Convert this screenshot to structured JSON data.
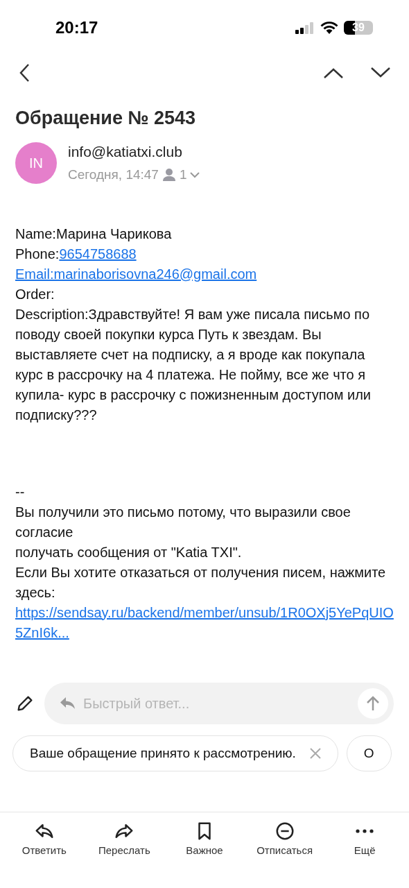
{
  "status_bar": {
    "time": "20:17",
    "battery": "39"
  },
  "subject": "Обращение № 2543",
  "sender": {
    "initials": "IN",
    "color": "#e57fcb",
    "address": "info@katiatxi.club",
    "date": "Сегодня, 14:47",
    "recipients": "1"
  },
  "body": [
    {
      "parts": [
        {
          "kind": "text",
          "text": "Name:Марина Чарикова"
        }
      ]
    },
    {
      "parts": [
        {
          "kind": "text",
          "text": "Phone:"
        },
        {
          "kind": "link",
          "text": "9654758688"
        }
      ]
    },
    {
      "parts": [
        {
          "kind": "link",
          "text": "Email:marinaborisovna246@gmail.com"
        }
      ]
    },
    {
      "parts": [
        {
          "kind": "text",
          "text": "Order:"
        }
      ]
    },
    {
      "parts": [
        {
          "kind": "text",
          "text": "Description:Здравствуйте! Я вам уже писала письмо по поводу своей покупки курса Путь к звездам. Вы выставляете счет на подписку, а я вроде как покупала курс в рассрочку на 4 платежа. Не пойму, все же что я купила- курс в рассрочку с пожизненным доступом или подписку???"
        }
      ]
    }
  ],
  "footer": [
    {
      "parts": [
        {
          "kind": "text",
          "text": "--"
        }
      ]
    },
    {
      "parts": [
        {
          "kind": "text",
          "text": "Вы получили это письмо потому, что выразили свое согласие"
        }
      ]
    },
    {
      "parts": [
        {
          "kind": "text",
          "text": "получать сообщения от \"Katia TXI\"."
        }
      ]
    },
    {
      "parts": [
        {
          "kind": "text",
          "text": "Если Вы хотите отказаться от получения писем, нажмите здесь:"
        }
      ]
    },
    {
      "parts": [
        {
          "kind": "link",
          "text": "https://sendsay.ru/backend/member/unsub/1R0OXj5YePqUIO5ZnI6k..."
        }
      ]
    }
  ],
  "quick_reply": {
    "placeholder": "Быстрый ответ..."
  },
  "suggestions": [
    {
      "text": "Ваше обращение принято к рассмотрению."
    },
    {
      "text": "О"
    }
  ],
  "toolbar": [
    {
      "kind": "reply",
      "label": "Ответить"
    },
    {
      "kind": "forward",
      "label": "Переслать"
    },
    {
      "kind": "bookmark",
      "label": "Важное"
    },
    {
      "kind": "unsubscribe",
      "label": "Отписаться"
    },
    {
      "kind": "more",
      "label": "Ещё"
    }
  ]
}
